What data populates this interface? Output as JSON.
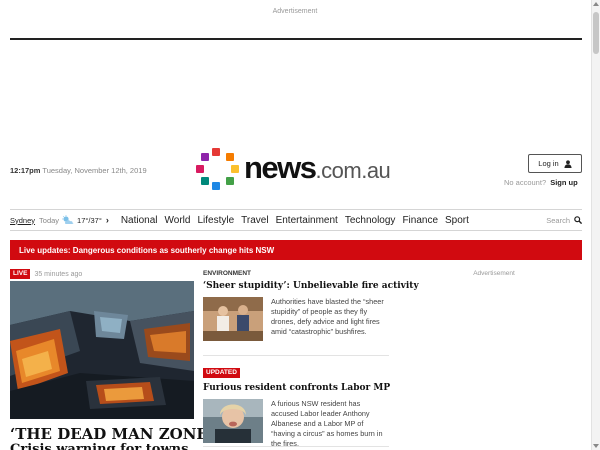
{
  "ads": {
    "top_label": "Advertisement",
    "right_label": "Advertisement"
  },
  "header": {
    "time": "12:17pm",
    "date": "Tuesday, November 12th, 2019",
    "logo_main": "news",
    "logo_suffix": ".com.au",
    "login_label": "Log in",
    "no_account": "No account?",
    "signup_label": "Sign up"
  },
  "weather": {
    "city": "Sydney",
    "day": "Today",
    "temp": "17°/37°",
    "icon": "partly-cloudy-icon"
  },
  "nav": {
    "items": [
      "National",
      "World",
      "Lifestyle",
      "Travel",
      "Entertainment",
      "Technology",
      "Finance",
      "Sport"
    ],
    "search_label": "Search"
  },
  "live_bar": {
    "text": "Live updates: Dangerous conditions as southerly change hits NSW"
  },
  "hero": {
    "badge": "LIVE",
    "time_ago": "35 minutes ago",
    "title": "‘THE DEAD MAN ZONE’:",
    "title_line2": "Crisis warning for towns"
  },
  "stories": [
    {
      "section": "ENVIRONMENT",
      "headline": "‘Sheer stupidity’: Unbelievable fire activity",
      "summary": "Authorities have blasted the “sheer stupidity” of people as they fly drones, defy advice and light fires amid “catastrophic” bushfires."
    },
    {
      "badge": "UPDATED",
      "headline": "Furious resident confronts Labor MP",
      "summary": "A furious NSW resident has accused Labor leader Anthony Albanese and a Labor MP of “having a circus” as homes burn in the fires."
    }
  ],
  "colors": {
    "brand_red": "#d10a10",
    "logo_dots": [
      "#e53935",
      "#f57c00",
      "#8e24aa",
      "#43a047",
      "#1e88e5",
      "#d81b60",
      "#00897b",
      "#fbc02d"
    ]
  }
}
